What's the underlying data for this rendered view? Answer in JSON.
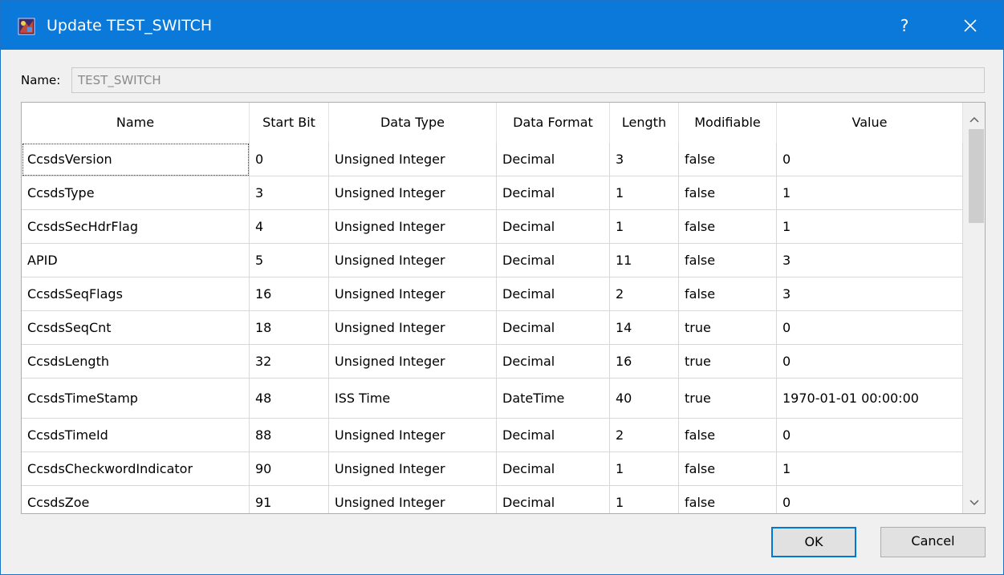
{
  "window": {
    "title": "Update TEST_SWITCH",
    "help_label": "?",
    "accent_color": "#0a79d9"
  },
  "name_field": {
    "label": "Name:",
    "value": "TEST_SWITCH"
  },
  "table": {
    "columns": [
      "Name",
      "Start Bit",
      "Data Type",
      "Data Format",
      "Length",
      "Modifiable",
      "Value"
    ],
    "rows": [
      [
        "CcsdsVersion",
        "0",
        "Unsigned Integer",
        "Decimal",
        "3",
        "false",
        "0"
      ],
      [
        "CcsdsType",
        "3",
        "Unsigned Integer",
        "Decimal",
        "1",
        "false",
        "1"
      ],
      [
        "CcsdsSecHdrFlag",
        "4",
        "Unsigned Integer",
        "Decimal",
        "1",
        "false",
        "1"
      ],
      [
        "APID",
        "5",
        "Unsigned Integer",
        "Decimal",
        "11",
        "false",
        "3"
      ],
      [
        "CcsdsSeqFlags",
        "16",
        "Unsigned Integer",
        "Decimal",
        "2",
        "false",
        "3"
      ],
      [
        "CcsdsSeqCnt",
        "18",
        "Unsigned Integer",
        "Decimal",
        "14",
        "true",
        "0"
      ],
      [
        "CcsdsLength",
        "32",
        "Unsigned Integer",
        "Decimal",
        "16",
        "true",
        "0"
      ],
      [
        "CcsdsTimeStamp",
        "48",
        "ISS Time",
        "DateTime",
        "40",
        "true",
        "1970-01-01 00:00:00"
      ],
      [
        "CcsdsTimeId",
        "88",
        "Unsigned Integer",
        "Decimal",
        "2",
        "false",
        "0"
      ],
      [
        "CcsdsCheckwordIndicator",
        "90",
        "Unsigned Integer",
        "Decimal",
        "1",
        "false",
        "1"
      ],
      [
        "CcsdsZoe",
        "91",
        "Unsigned Integer",
        "Decimal",
        "1",
        "false",
        "0"
      ]
    ]
  },
  "buttons": {
    "ok": "OK",
    "cancel": "Cancel"
  }
}
